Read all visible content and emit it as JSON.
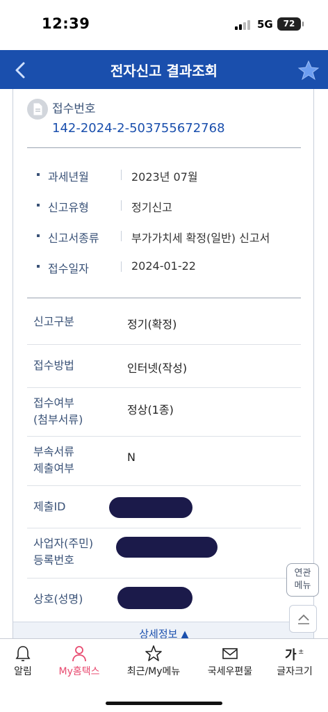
{
  "status_bar": {
    "time": "12:39",
    "network": "5G",
    "battery": "72"
  },
  "header": {
    "title": "전자신고 결과조회",
    "back_icon": "chevron-left-icon",
    "favorite_icon": "star-icon"
  },
  "receipt": {
    "label": "접수번호",
    "number": "142-2024-2-503755672768"
  },
  "summary": [
    {
      "key": "과세년월",
      "value": "2023년 07월"
    },
    {
      "key": "신고유형",
      "value": "정기신고"
    },
    {
      "key": "신고서종류",
      "value": "부가가치세 확정(일반) 신고서"
    },
    {
      "key": "접수일자",
      "value": "2024-01-22"
    }
  ],
  "details": [
    {
      "key": "신고구분",
      "value": "정기(확정)"
    },
    {
      "key": "접수방법",
      "value": "인터넷(작성)"
    },
    {
      "key_lines": [
        "접수여부",
        "(첨부서류)"
      ],
      "value": "정상(1종)"
    },
    {
      "key_lines": [
        "부속서류",
        "제출여부"
      ],
      "value": "N"
    },
    {
      "key": "제출ID",
      "value": "",
      "redacted": true
    },
    {
      "key_lines": [
        "사업자(주민)",
        "등록번호"
      ],
      "value": "",
      "redacted": true
    },
    {
      "key": "상호(성명)",
      "value": "",
      "redacted": true
    }
  ],
  "more_button": {
    "label": "상세정보 ▲"
  },
  "floating": {
    "related_lines": [
      "연관",
      "메뉴"
    ],
    "top_icon": "chevron-up-icon"
  },
  "bottom_nav": [
    {
      "label": "알림",
      "icon": "bell-icon",
      "active": false
    },
    {
      "label": "My홈택스",
      "icon": "person-icon",
      "active": true
    },
    {
      "label": "최근/My메뉴",
      "icon": "star-outline-icon",
      "active": false
    },
    {
      "label": "국세우편물",
      "icon": "mail-icon",
      "active": false
    },
    {
      "label": "글자크기",
      "icon": "text-size-icon",
      "active": false
    }
  ],
  "colors": {
    "header_bg": "#1a4fad",
    "link": "#1a4fad",
    "label": "#3a5277",
    "active_nav": "#e84a6f"
  }
}
